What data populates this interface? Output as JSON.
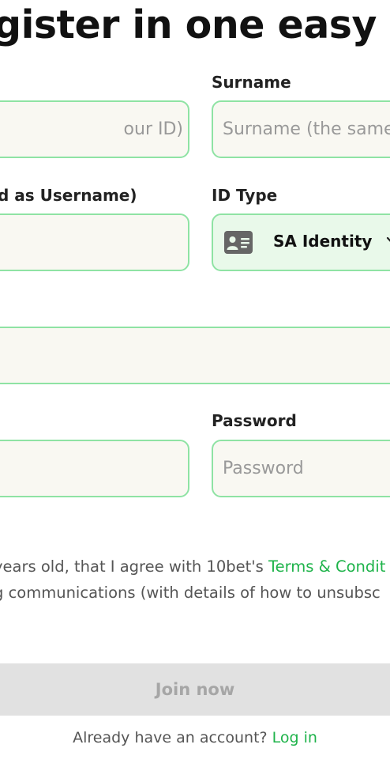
{
  "header": {
    "title": "gister in one easy st"
  },
  "form": {
    "id_field": {
      "placeholder": "our ID)"
    },
    "surname": {
      "label": "Surname",
      "placeholder": "Surname (the same"
    },
    "username_label": "d as Username)",
    "username_field": {
      "value": ""
    },
    "id_type": {
      "label": "ID Type",
      "selected": "SA Identity",
      "icon": "id-card-icon"
    },
    "wide_field": {
      "value": ""
    },
    "password_left_field": {
      "value": ""
    },
    "password": {
      "label": "Password",
      "placeholder": "Password"
    }
  },
  "consent": {
    "line1_text": "years old, that I agree with 10bet's ",
    "terms_link": "Terms & Condit",
    "line2_text": "g communications (with details of how to unsubsc"
  },
  "actions": {
    "join_label": "Join now",
    "already_text": "Already have an account?",
    "login_label": "Log in"
  },
  "colors": {
    "accent_green": "#1eb34a",
    "field_border": "#8fe3a4",
    "field_bg": "#f9f8f2",
    "select_bg": "#e9f9ea",
    "button_disabled_bg": "#e1e1e1",
    "button_disabled_text": "#a6a6a6"
  }
}
